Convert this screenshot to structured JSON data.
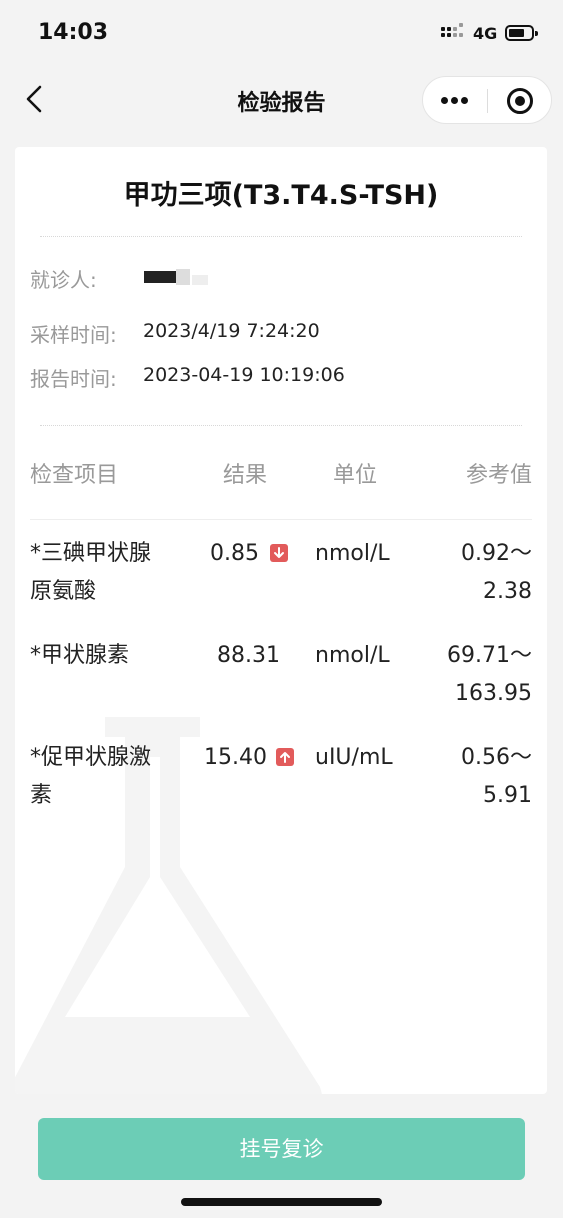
{
  "status_bar": {
    "time": "14:03",
    "network": "4G"
  },
  "nav": {
    "title": "检验报告"
  },
  "report": {
    "title": "甲功三项(T3.T4.S-TSH)",
    "patient_label": "就诊人:",
    "patient_value": "",
    "sample_time_label": "采样时间:",
    "sample_time_value": "2023/4/19 7:24:20",
    "report_time_label": "报告时间:",
    "report_time_value": "2023-04-19 10:19:06"
  },
  "table": {
    "headers": {
      "item": "检查项目",
      "result": "结果",
      "unit": "单位",
      "reference": "参考值"
    },
    "rows": [
      {
        "name_line1": "*三碘甲状腺",
        "name_line2": "原氨酸",
        "result": "0.85",
        "flag": "low",
        "unit": "nmol/L",
        "ref_line1": "0.92～",
        "ref_line2": "2.38"
      },
      {
        "name_line1": "*甲状腺素",
        "name_line2": "",
        "result": "88.31",
        "flag": "normal",
        "unit": "nmol/L",
        "ref_line1": "69.71～",
        "ref_line2": "163.95"
      },
      {
        "name_line1": "*促甲状腺激",
        "name_line2": "素",
        "result": "15.40",
        "flag": "high",
        "unit": "uIU/mL",
        "ref_line1": "0.56～",
        "ref_line2": "5.91"
      }
    ]
  },
  "footer": {
    "button_label": "挂号复诊"
  },
  "colors": {
    "accent": "#6ccdb6",
    "flag": "#e25b5b",
    "label": "#999999"
  },
  "icons": [
    "back-icon",
    "more-icon",
    "close-icon",
    "arrow-down-icon",
    "arrow-up-icon",
    "flask-icon"
  ]
}
